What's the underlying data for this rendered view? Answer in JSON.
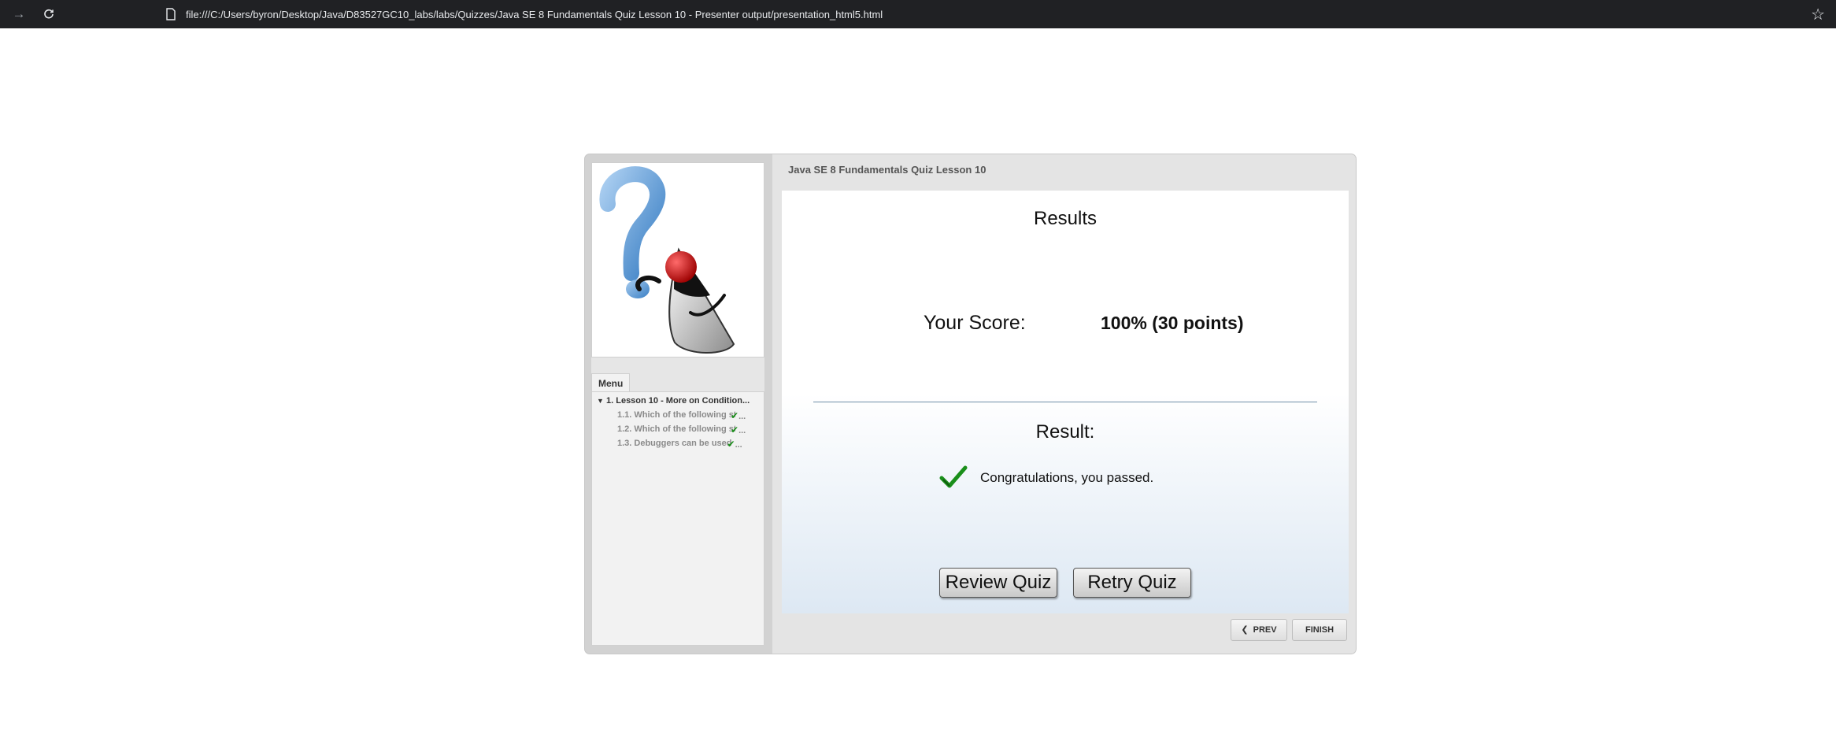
{
  "browser": {
    "url": "file:///C:/Users/byron/Desktop/Java/D83527GC10_labs/labs/Quizzes/Java SE 8 Fundamentals Quiz Lesson 10 - Presenter output/presentation_html5.html",
    "icons": {
      "back": "back-arrow-icon",
      "reload": "reload-icon",
      "file": "file-icon",
      "bookmark": "star-icon"
    }
  },
  "player": {
    "title": "Java SE 8 Fundamentals Quiz Lesson 10",
    "menu": {
      "tab_label": "Menu",
      "lesson": "1. Lesson 10 - More on Condition...",
      "items": [
        {
          "label": "1.1. Which of the following st",
          "completed": true
        },
        {
          "label": "1.2. Which of the following st",
          "completed": true
        },
        {
          "label": "1.3. Debuggers can be used ",
          "completed": true
        }
      ]
    },
    "results": {
      "heading": "Results",
      "score_label": "Your Score:",
      "score_value": "100% (30 points)",
      "result_label": "Result:",
      "message": "Congratulations, you passed.",
      "review_button": "Review Quiz",
      "retry_button": "Retry Quiz"
    },
    "nav": {
      "prev": "PREV",
      "finish": "FINISH"
    },
    "colors": {
      "check_green": "#1a8f1a",
      "divider": "#6f8fa8"
    }
  }
}
